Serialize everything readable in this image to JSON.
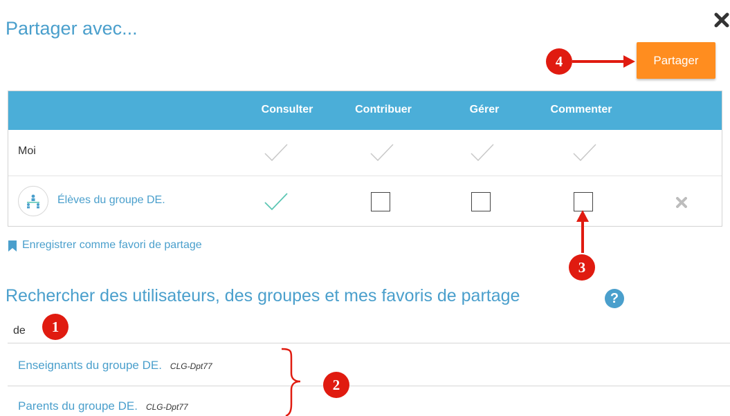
{
  "dialog": {
    "title": "Partager avec...",
    "close_icon": "close-icon",
    "share_button": "Partager"
  },
  "table": {
    "headers": [
      "Consulter",
      "Contribuer",
      "Gérer",
      "Commenter"
    ],
    "rows": [
      {
        "label": "Moi",
        "consulter": "implicit-check",
        "contribuer": "implicit-check",
        "gerer": "implicit-check",
        "commenter": "implicit-check"
      },
      {
        "label": "Élèves du groupe DE.",
        "icon": "group-icon",
        "consulter": "checked",
        "contribuer": "unchecked",
        "gerer": "unchecked",
        "commenter": "unchecked",
        "remove_icon": "remove-icon"
      }
    ]
  },
  "favorite_link": "Enregistrer comme favori de partage",
  "search": {
    "title": "Rechercher des utilisateurs, des groupes et mes favoris de partage",
    "help_icon": "?",
    "value": "de"
  },
  "results": [
    {
      "name": "Enseignants du groupe DE.",
      "school": "CLG-Dpt77"
    },
    {
      "name": "Parents du groupe DE.",
      "school": "CLG-Dpt77"
    }
  ],
  "annotations": [
    "1",
    "2",
    "3",
    "4"
  ],
  "colors": {
    "accent": "#4a9fcc",
    "header_bg": "#4baed8",
    "share_button": "#ff8d1f",
    "marker": "#e01b10",
    "check_on": "#5cc6b4"
  }
}
